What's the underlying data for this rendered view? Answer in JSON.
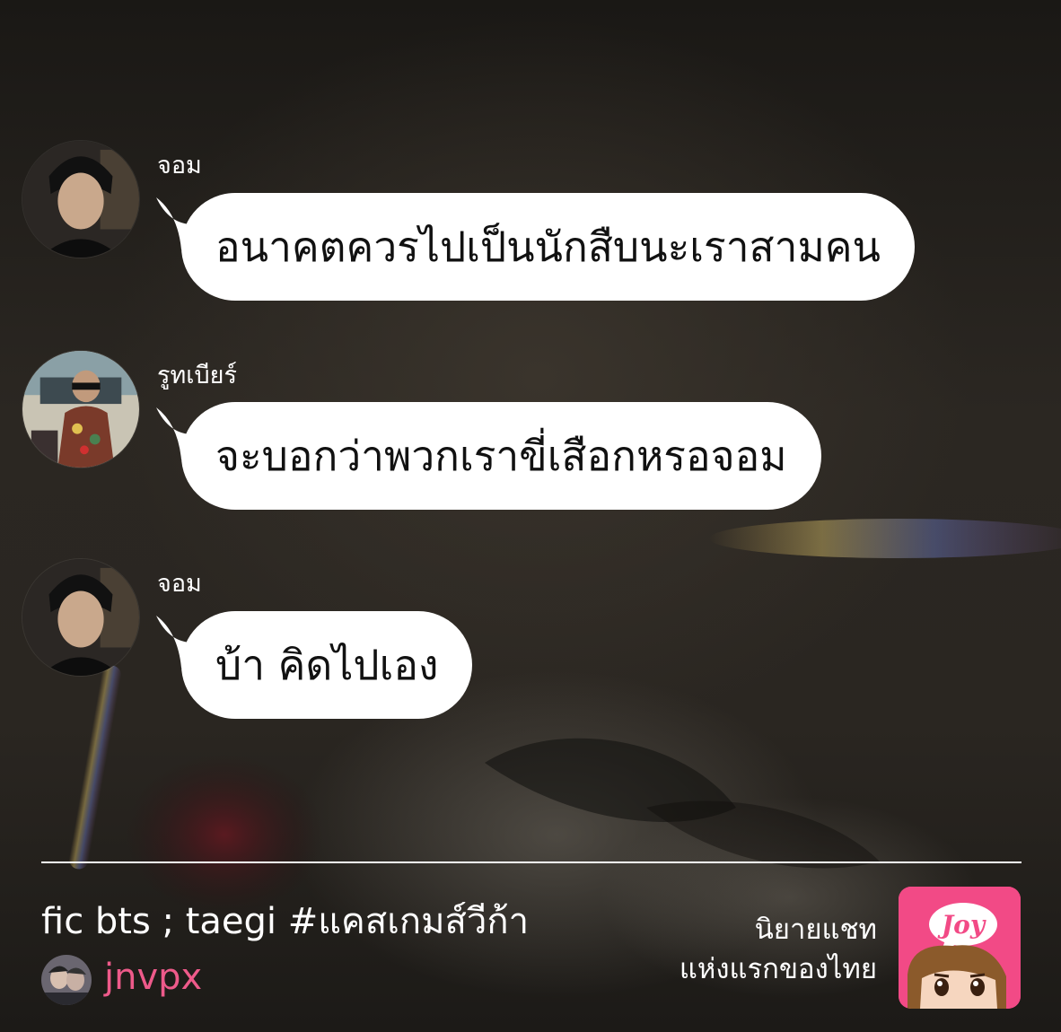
{
  "messages": [
    {
      "sender": "จอม",
      "text": "อนาคตควรไปเป็นนักสืบนะเราสามคน",
      "avatar_icon": "profile-photo-icon"
    },
    {
      "sender": "รูทเบียร์",
      "text": "จะบอกว่าพวกเราขี่เสือกหรอจอม",
      "avatar_icon": "profile-photo-icon"
    },
    {
      "sender": "จอม",
      "text": "บ้า คิดไปเอง",
      "avatar_icon": "profile-photo-icon"
    }
  ],
  "footer": {
    "title": "fic bts ; taegi #แคสเกมส์วีก้า",
    "author": "jnvpx",
    "tagline_line1": "นิยายแชท",
    "tagline_line2": "แห่งแรกของไทย",
    "logo_text": "Joy"
  },
  "colors": {
    "bubble": "#ffffff",
    "author": "#ee5a8a",
    "logo_bg": "#f24a86"
  }
}
